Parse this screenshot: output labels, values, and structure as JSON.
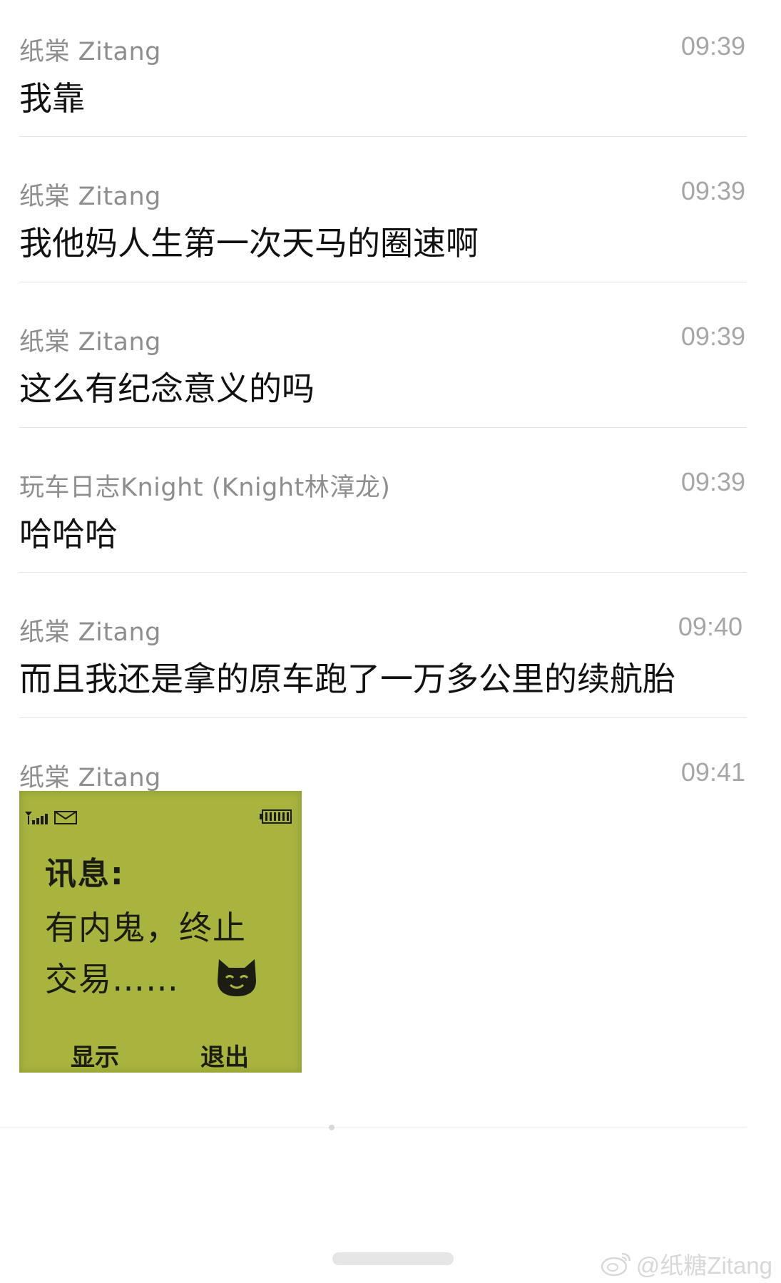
{
  "messages": [
    {
      "sender": "纸棠 Zitang",
      "time": "09:39",
      "text": "我靠"
    },
    {
      "sender": "纸棠 Zitang",
      "time": "09:39",
      "text": "我他妈人生第一次天马的圈速啊"
    },
    {
      "sender": "纸棠 Zitang",
      "time": "09:39",
      "text": "这么有纪念意义的吗"
    },
    {
      "sender": "玩车日志Knight (Knight林漳龙)",
      "time": "09:39",
      "text": "哈哈哈"
    },
    {
      "sender": "纸棠 Zitang",
      "time": "09:40",
      "text": "而且我还是拿的原车跑了一万多公里的续航胎"
    },
    {
      "sender": "纸棠 Zitang",
      "time": "09:41",
      "text": ""
    }
  ],
  "sticker": {
    "title": "讯息:",
    "line1": "有内鬼，终止",
    "line2": "交易……",
    "softkey_left": "显示",
    "softkey_right": "退出",
    "screen_color": "#a8b43e",
    "icons": [
      "signal-icon",
      "envelope-icon",
      "battery-icon",
      "cat-face-icon"
    ]
  },
  "watermark": {
    "text": "@纸糖Zitang",
    "icon": "weibo-icon"
  },
  "colors": {
    "sender": "#8e8e8e",
    "time": "#a6a6a6",
    "text": "#111111",
    "divider": "#e4e4e4"
  }
}
